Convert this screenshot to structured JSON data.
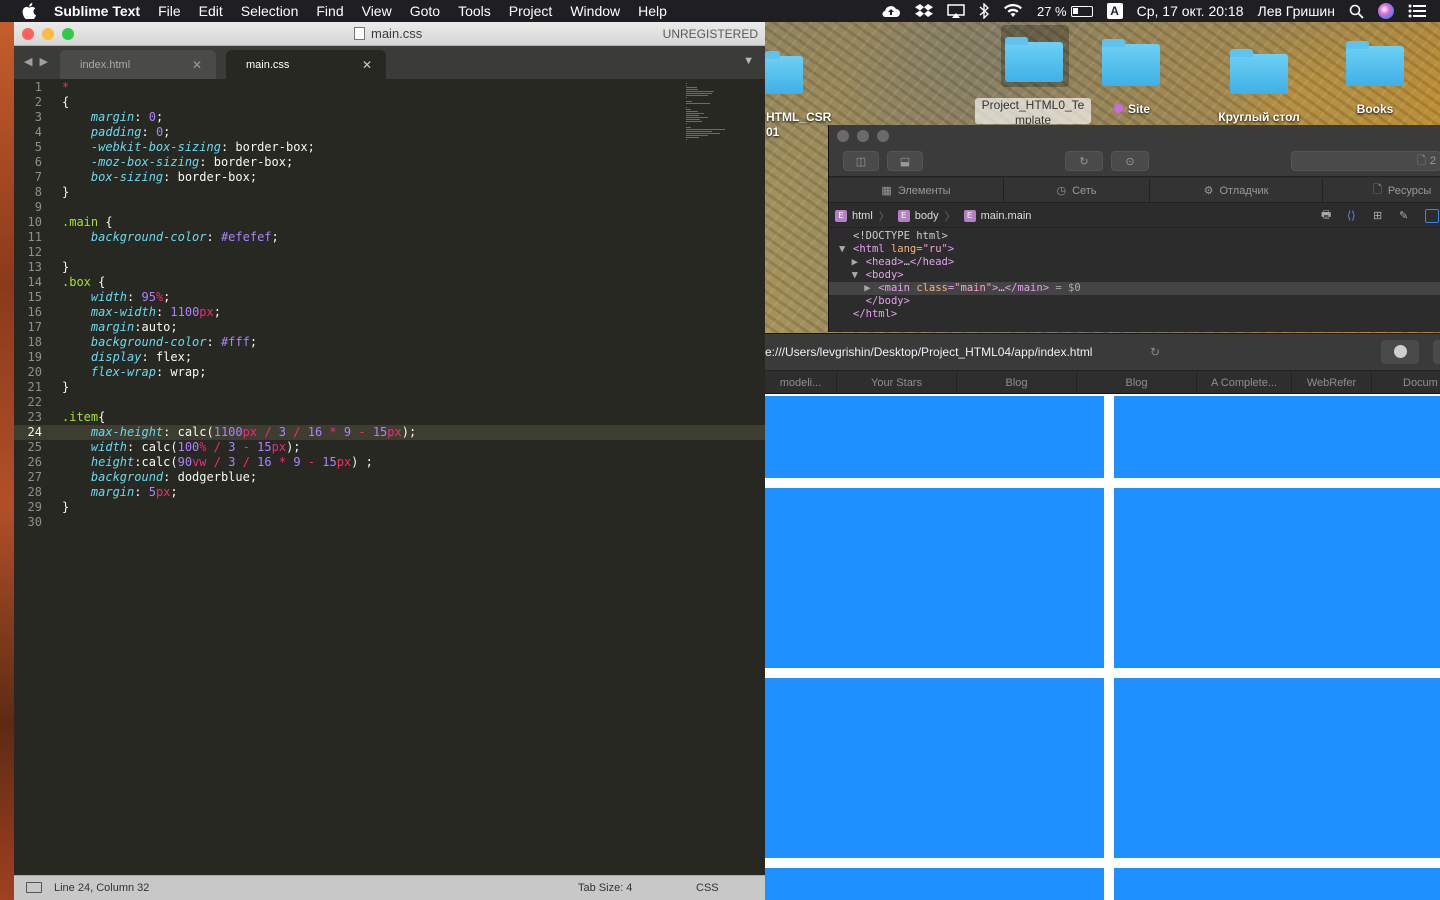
{
  "menubar": {
    "app": "Sublime Text",
    "items": [
      "File",
      "Edit",
      "Selection",
      "Find",
      "View",
      "Goto",
      "Tools",
      "Project",
      "Window",
      "Help"
    ],
    "battery": "27 %",
    "input": "A",
    "clock": "Ср, 17 окт.  20:18",
    "user": "Лев Гришин"
  },
  "sublime": {
    "title": "main.css",
    "unregistered": "UNREGISTERED",
    "tabs": [
      {
        "label": "index.html"
      },
      {
        "label": "main.css"
      }
    ],
    "current_line": 24,
    "lines": [
      {
        "n": "1",
        "toks": [
          [
            "op",
            "*"
          ]
        ]
      },
      {
        "n": "2",
        "toks": [
          [
            "",
            "{"
          ]
        ]
      },
      {
        "n": "3",
        "toks": [
          [
            "",
            "    "
          ],
          [
            "pr",
            "margin"
          ],
          [
            "",
            ": "
          ],
          [
            "nm",
            "0"
          ],
          [
            "",
            ";"
          ]
        ]
      },
      {
        "n": "4",
        "toks": [
          [
            "",
            "    "
          ],
          [
            "pr",
            "padding"
          ],
          [
            "",
            ": "
          ],
          [
            "nm",
            "0"
          ],
          [
            "",
            ";"
          ]
        ]
      },
      {
        "n": "5",
        "toks": [
          [
            "",
            "    "
          ],
          [
            "pr",
            "-webkit-box-sizing"
          ],
          [
            "",
            ": border-box;"
          ]
        ]
      },
      {
        "n": "6",
        "toks": [
          [
            "",
            "    "
          ],
          [
            "pr",
            "-moz-box-sizing"
          ],
          [
            "",
            ": border-box;"
          ]
        ]
      },
      {
        "n": "7",
        "toks": [
          [
            "",
            "    "
          ],
          [
            "pr",
            "box-sizing"
          ],
          [
            "",
            ": border-box;"
          ]
        ]
      },
      {
        "n": "8",
        "toks": [
          [
            "",
            "}"
          ]
        ]
      },
      {
        "n": "9",
        "toks": []
      },
      {
        "n": "10",
        "toks": [
          [
            "sel",
            ".main"
          ],
          [
            "",
            " {"
          ]
        ]
      },
      {
        "n": "11",
        "toks": [
          [
            "",
            "    "
          ],
          [
            "pr",
            "background-color"
          ],
          [
            "",
            ": "
          ],
          [
            "nm",
            "#efefef"
          ],
          [
            "",
            ";"
          ]
        ]
      },
      {
        "n": "12",
        "toks": []
      },
      {
        "n": "13",
        "toks": [
          [
            "",
            "}"
          ]
        ]
      },
      {
        "n": "14",
        "toks": [
          [
            "sel",
            ".box"
          ],
          [
            "",
            " {"
          ]
        ]
      },
      {
        "n": "15",
        "toks": [
          [
            "",
            "    "
          ],
          [
            "pr",
            "width"
          ],
          [
            "",
            ": "
          ],
          [
            "nm",
            "95"
          ],
          [
            "un",
            "%"
          ],
          [
            "",
            ";"
          ]
        ]
      },
      {
        "n": "16",
        "toks": [
          [
            "",
            "    "
          ],
          [
            "pr",
            "max-width"
          ],
          [
            "",
            ": "
          ],
          [
            "nm",
            "1100"
          ],
          [
            "un",
            "px"
          ],
          [
            "",
            ";"
          ]
        ]
      },
      {
        "n": "17",
        "toks": [
          [
            "",
            "    "
          ],
          [
            "pr",
            "margin"
          ],
          [
            "",
            ":auto;"
          ]
        ]
      },
      {
        "n": "18",
        "toks": [
          [
            "",
            "    "
          ],
          [
            "pr",
            "background-color"
          ],
          [
            "",
            ": "
          ],
          [
            "nm",
            "#fff"
          ],
          [
            "",
            ";"
          ]
        ]
      },
      {
        "n": "19",
        "toks": [
          [
            "",
            "    "
          ],
          [
            "pr",
            "display"
          ],
          [
            "",
            ": flex;"
          ]
        ]
      },
      {
        "n": "20",
        "toks": [
          [
            "",
            "    "
          ],
          [
            "pr",
            "flex-wrap"
          ],
          [
            "",
            ": wrap;"
          ]
        ]
      },
      {
        "n": "21",
        "toks": [
          [
            "",
            "}"
          ]
        ]
      },
      {
        "n": "22",
        "toks": []
      },
      {
        "n": "23",
        "toks": [
          [
            "sel",
            ".item"
          ],
          [
            "",
            "{"
          ]
        ]
      },
      {
        "n": "24",
        "toks": [
          [
            "",
            "    "
          ],
          [
            "pr",
            "max-height"
          ],
          [
            "",
            ": calc("
          ],
          [
            "nm",
            "1100"
          ],
          [
            "un",
            "px"
          ],
          [
            "",
            " "
          ],
          [
            "op",
            "/"
          ],
          [
            "",
            " "
          ],
          [
            "nm",
            "3"
          ],
          [
            "",
            " "
          ],
          [
            "op",
            "/"
          ],
          [
            "",
            " "
          ],
          [
            "nm",
            "16"
          ],
          [
            "",
            " "
          ],
          [
            "op",
            "*"
          ],
          [
            "",
            " "
          ],
          [
            "nm",
            "9"
          ],
          [
            "",
            " "
          ],
          [
            "op",
            "-"
          ],
          [
            "",
            " "
          ],
          [
            "nm",
            "15"
          ],
          [
            "un",
            "px"
          ],
          [
            "",
            ");"
          ]
        ]
      },
      {
        "n": "25",
        "toks": [
          [
            "",
            "    "
          ],
          [
            "pr",
            "width"
          ],
          [
            "",
            ": calc("
          ],
          [
            "nm",
            "100"
          ],
          [
            "un",
            "%"
          ],
          [
            "",
            " "
          ],
          [
            "op",
            "/"
          ],
          [
            "",
            " "
          ],
          [
            "nm",
            "3"
          ],
          [
            "",
            " "
          ],
          [
            "op",
            "-"
          ],
          [
            "",
            " "
          ],
          [
            "nm",
            "15"
          ],
          [
            "un",
            "px"
          ],
          [
            "",
            ");"
          ]
        ]
      },
      {
        "n": "26",
        "toks": [
          [
            "",
            "    "
          ],
          [
            "pr",
            "height"
          ],
          [
            "",
            ":calc("
          ],
          [
            "nm",
            "90"
          ],
          [
            "un",
            "vw"
          ],
          [
            "",
            " "
          ],
          [
            "op",
            "/"
          ],
          [
            "",
            " "
          ],
          [
            "nm",
            "3"
          ],
          [
            "",
            " "
          ],
          [
            "op",
            "/"
          ],
          [
            "",
            " "
          ],
          [
            "nm",
            "16"
          ],
          [
            "",
            " "
          ],
          [
            "op",
            "*"
          ],
          [
            "",
            " "
          ],
          [
            "nm",
            "9"
          ],
          [
            "",
            " "
          ],
          [
            "op",
            "-"
          ],
          [
            "",
            " "
          ],
          [
            "nm",
            "15"
          ],
          [
            "un",
            "px"
          ],
          [
            "",
            ") ;"
          ]
        ]
      },
      {
        "n": "27",
        "toks": [
          [
            "",
            "    "
          ],
          [
            "pr",
            "background"
          ],
          [
            "",
            ": dodgerblue;"
          ]
        ]
      },
      {
        "n": "28",
        "toks": [
          [
            "",
            "    "
          ],
          [
            "pr",
            "margin"
          ],
          [
            "",
            ": "
          ],
          [
            "nm",
            "5"
          ],
          [
            "un",
            "px"
          ],
          [
            "",
            ";"
          ]
        ]
      },
      {
        "n": "29",
        "toks": [
          [
            "",
            "}"
          ]
        ]
      },
      {
        "n": "30",
        "toks": []
      }
    ],
    "status": {
      "position": "Line 24, Column 32",
      "tab_size": "Tab Size: 4",
      "syntax": "CSS"
    }
  },
  "desktop": {
    "icons": [
      {
        "label": "HTML_CSR\n01"
      },
      {
        "label": "Project_HTML0_Te\nmplate"
      },
      {
        "label": "Site"
      },
      {
        "label": "Круглый стол"
      },
      {
        "label": "Books"
      }
    ]
  },
  "inspector": {
    "badge": "2",
    "tabs": [
      "Элементы",
      "Сеть",
      "Отладчик",
      "Ресурсы"
    ],
    "crumbs": [
      "html",
      "body",
      "main.main"
    ],
    "dom": [
      {
        "indent": "",
        "tri": "",
        "parts": [
          [
            "",
            "<!DOCTYPE html>"
          ]
        ]
      },
      {
        "indent": "",
        "tri": "▼",
        "parts": [
          [
            "tg",
            "<html "
          ],
          [
            "at",
            "lang"
          ],
          [
            "tg",
            "="
          ],
          [
            "av",
            "\"ru\""
          ],
          [
            "tg",
            ">"
          ]
        ]
      },
      {
        "indent": "  ",
        "tri": "▶",
        "parts": [
          [
            "tg",
            "<head>"
          ],
          [
            "",
            "…"
          ],
          [
            "tg",
            "</head>"
          ]
        ]
      },
      {
        "indent": "  ",
        "tri": "▼",
        "parts": [
          [
            "tg",
            "<body>"
          ]
        ]
      },
      {
        "indent": "    ",
        "tri": "▶",
        "parts": [
          [
            "tg",
            "<main "
          ],
          [
            "at",
            "class"
          ],
          [
            "tg",
            "="
          ],
          [
            "av",
            "\"main\""
          ],
          [
            "tg",
            ">"
          ],
          [
            "",
            "…"
          ],
          [
            "tg",
            "</main>"
          ],
          [
            "dollar",
            " = $0"
          ]
        ]
      },
      {
        "indent": "  ",
        "tri": "",
        "parts": [
          [
            "tg",
            "</body>"
          ]
        ]
      },
      {
        "indent": "",
        "tri": "",
        "parts": [
          [
            "tg",
            "</html>"
          ]
        ]
      }
    ]
  },
  "browser": {
    "url": "e:///Users/levgrishin/Desktop/Project_HTML04/app/index.html",
    "favorites": [
      "modeli...",
      "Your Stars",
      "Blog",
      "Blog",
      "A Complete...",
      "WebRefer",
      "Docum"
    ],
    "item_color": "#1e90ff"
  }
}
